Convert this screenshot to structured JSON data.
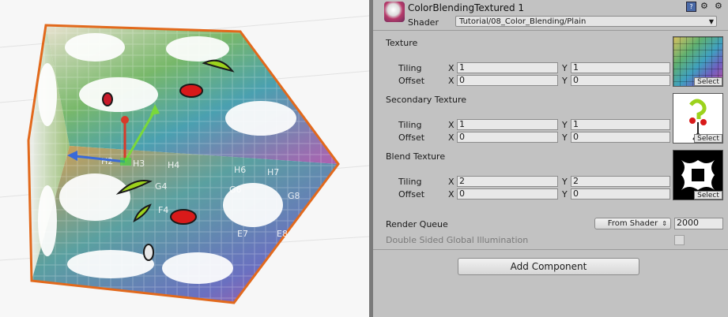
{
  "material": {
    "name": "ColorBlendingTextured 1",
    "shader_label": "Shader",
    "shader_value": "Tutorial/08_Color_Blending/Plain"
  },
  "textures": [
    {
      "title": "Texture",
      "tiling": {
        "x": "1",
        "y": "1"
      },
      "offset": {
        "x": "0",
        "y": "0"
      }
    },
    {
      "title": "Secondary Texture",
      "tiling": {
        "x": "1",
        "y": "1"
      },
      "offset": {
        "x": "0",
        "y": "0"
      }
    },
    {
      "title": "Blend Texture",
      "tiling": {
        "x": "2",
        "y": "2"
      },
      "offset": {
        "x": "0",
        "y": "0"
      }
    }
  ],
  "labels": {
    "tiling": "Tiling",
    "offset": "Offset",
    "x": "X",
    "y": "Y",
    "select": "Select"
  },
  "render_queue": {
    "label": "Render Queue",
    "mode": "From Shader",
    "value": "2000"
  },
  "double_sided_gi": {
    "label": "Double Sided Global Illumination",
    "checked": false
  },
  "add_component": "Add Component",
  "scene_cells": {
    "row1": [
      "H2",
      "H3",
      "H4",
      "H6",
      "H7"
    ],
    "row2": [
      "G4",
      "G6",
      "G8",
      "F4",
      "E7",
      "E8"
    ]
  }
}
